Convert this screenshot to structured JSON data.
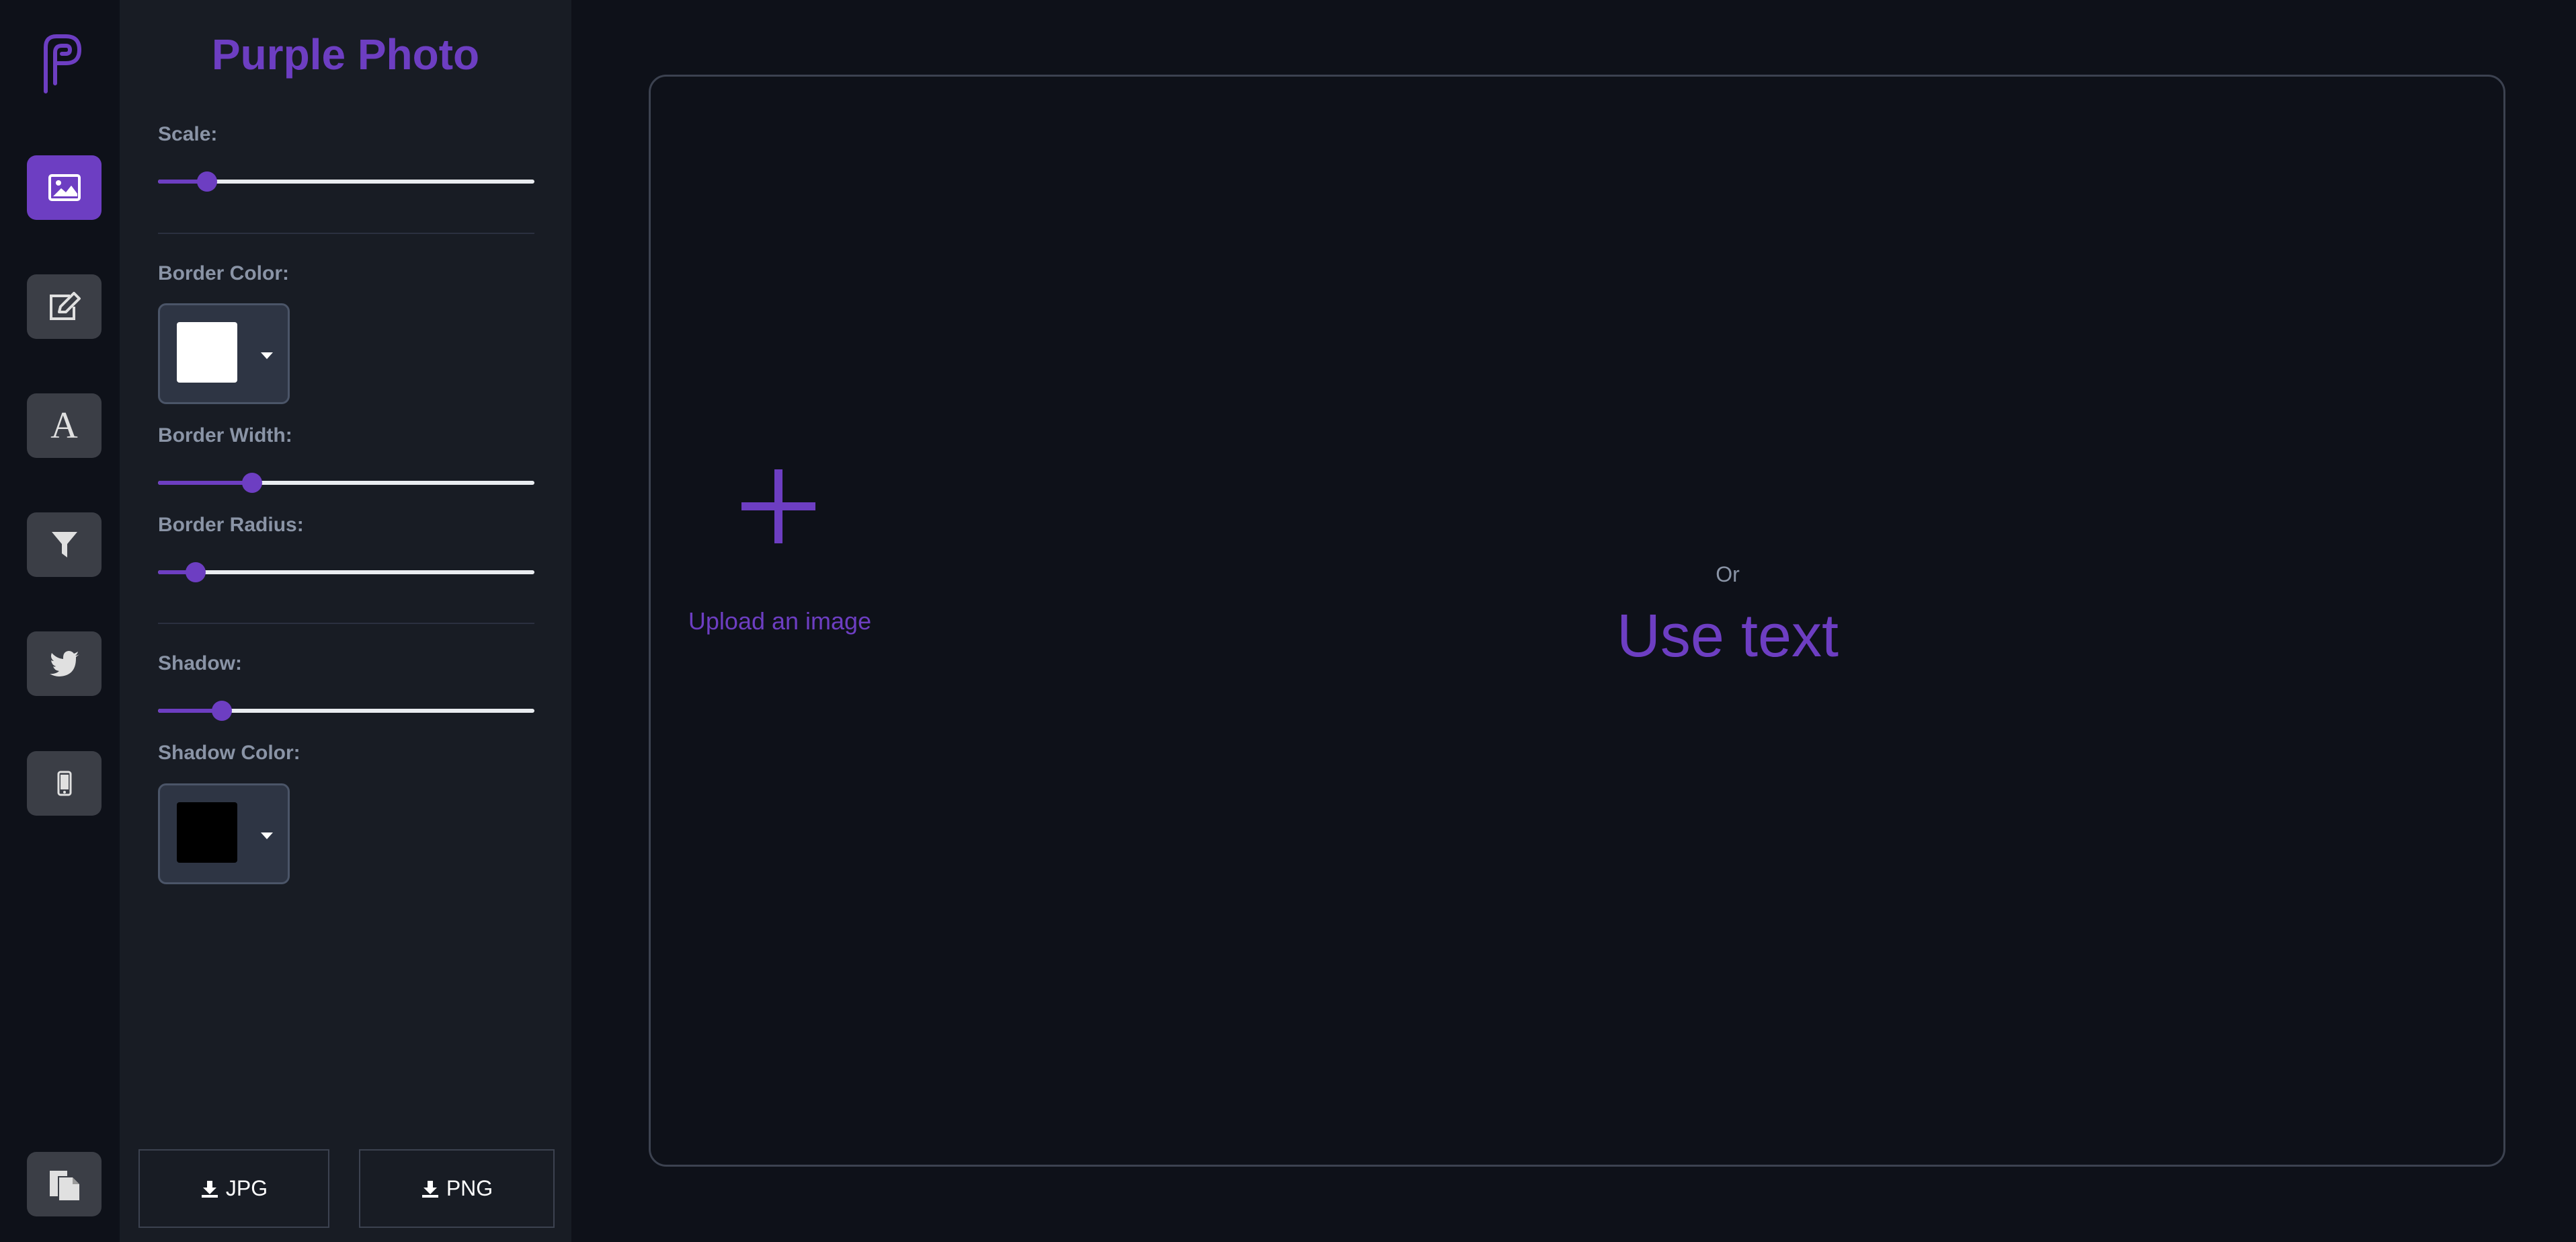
{
  "app": {
    "brand_title": "Purple Photo",
    "accent_color": "#6d3ec2"
  },
  "rail": {
    "items": [
      {
        "icon": "image-icon",
        "active": true
      },
      {
        "icon": "edit-icon",
        "active": false
      },
      {
        "icon": "text-icon",
        "glyph": "A",
        "active": false
      },
      {
        "icon": "filter-icon",
        "active": false
      },
      {
        "icon": "twitter-icon",
        "active": false
      },
      {
        "icon": "mobile-icon",
        "active": false
      }
    ],
    "bottom_item": {
      "icon": "clipboard-icon"
    }
  },
  "settings": {
    "scale": {
      "label": "Scale:",
      "value": 0.13
    },
    "border_color": {
      "label": "Border Color:",
      "color": "#ffffff"
    },
    "border_width": {
      "label": "Border Width:",
      "value": 0.25
    },
    "border_radius": {
      "label": "Border Radius:",
      "value": 0.1
    },
    "shadow": {
      "label": "Shadow:",
      "value": 0.17
    },
    "shadow_color": {
      "label": "Shadow Color:",
      "color": "#000000"
    }
  },
  "export": {
    "jpg_label": "JPG",
    "png_label": "PNG",
    "icon": "download-icon"
  },
  "canvas": {
    "upload_label": "Upload an image",
    "or_label": "Or",
    "use_text_label": "Use text"
  }
}
